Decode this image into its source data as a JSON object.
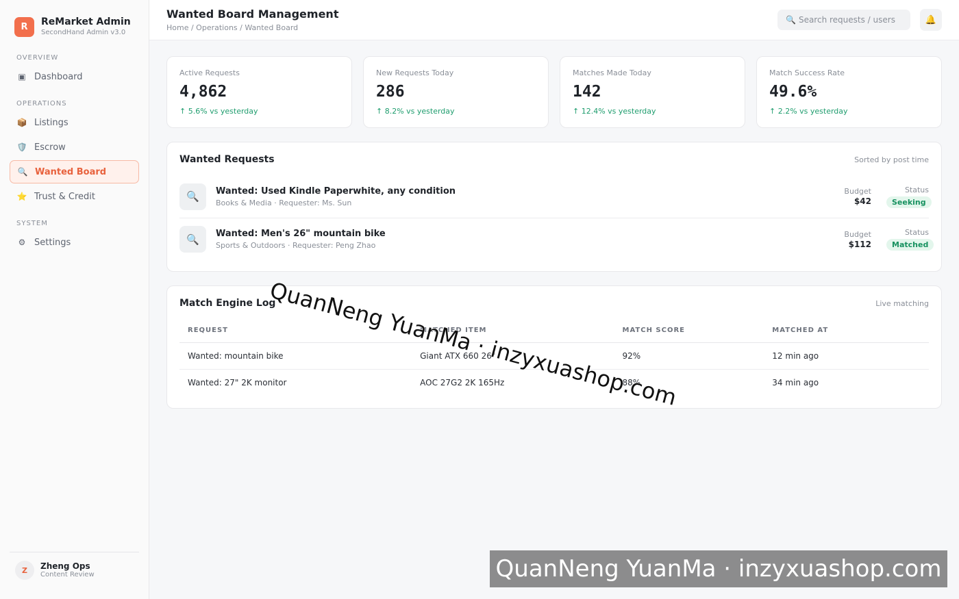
{
  "brand": {
    "logo_letter": "R",
    "name": "ReMarket Admin",
    "subtitle": "SecondHand Admin v3.0"
  },
  "sidebar": {
    "sections": [
      {
        "title": "OVERVIEW",
        "items": [
          {
            "label": "Dashboard",
            "icon": "dashboard-icon",
            "glyph": "▣"
          }
        ]
      },
      {
        "title": "OPERATIONS",
        "items": [
          {
            "label": "Listings",
            "icon": "package-icon",
            "glyph": "📦"
          },
          {
            "label": "Escrow",
            "icon": "shield-icon",
            "glyph": "🛡️"
          },
          {
            "label": "Wanted Board",
            "icon": "search-icon",
            "glyph": "🔍",
            "active": true
          },
          {
            "label": "Trust & Credit",
            "icon": "star-icon",
            "glyph": "⭐"
          }
        ]
      },
      {
        "title": "SYSTEM",
        "items": [
          {
            "label": "Settings",
            "icon": "gear-icon",
            "glyph": "⚙"
          }
        ]
      }
    ],
    "user": {
      "initial": "Z",
      "name": "Zheng Ops",
      "role": "Content Review"
    }
  },
  "header": {
    "title": "Wanted Board Management",
    "breadcrumb": "Home / Operations / Wanted Board",
    "search_placeholder": "Search requests / users",
    "search_icon": "🔍",
    "bell_icon": "🔔"
  },
  "stats": [
    {
      "label": "Active Requests",
      "value": "4,862",
      "delta": "↑ 5.6% vs yesterday"
    },
    {
      "label": "New Requests Today",
      "value": "286",
      "delta": "↑ 8.2% vs yesterday"
    },
    {
      "label": "Matches Made Today",
      "value": "142",
      "delta": "↑ 12.4% vs yesterday"
    },
    {
      "label": "Match Success Rate",
      "value": "49.6%",
      "delta": "↑ 2.2% vs yesterday"
    }
  ],
  "wanted": {
    "title": "Wanted Requests",
    "note": "Sorted by post time",
    "budget_label": "Budget",
    "status_label": "Status",
    "items": [
      {
        "icon": "🔍",
        "title": "Wanted: Used Kindle Paperwhite, any condition",
        "meta": "Books & Media · Requester: Ms. Sun",
        "budget": "$42",
        "status": "Seeking"
      },
      {
        "icon": "🔍",
        "title": "Wanted: Men's 26\" mountain bike",
        "meta": "Sports & Outdoors · Requester: Peng Zhao",
        "budget": "$112",
        "status": "Matched"
      }
    ]
  },
  "log": {
    "title": "Match Engine Log",
    "note": "Live matching",
    "columns": [
      "REQUEST",
      "MATCHED ITEM",
      "MATCH SCORE",
      "MATCHED AT"
    ],
    "rows": [
      [
        "Wanted: mountain bike",
        "Giant ATX 660 26\"",
        "92%",
        "12 min ago"
      ],
      [
        "Wanted: 27\" 2K monitor",
        "AOC 27G2 2K 165Hz",
        "88%",
        "34 min ago"
      ]
    ]
  },
  "watermark": {
    "text": "QuanNeng YuanMa · inzyxuashop.com"
  },
  "colors": {
    "accent": "#f26f4c",
    "success": "#1f9d6e",
    "badge_bg": "#e3f6ec"
  }
}
